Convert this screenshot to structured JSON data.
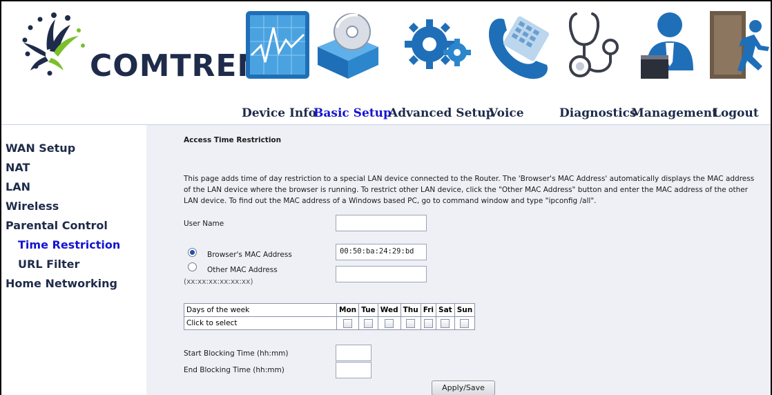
{
  "brand": {
    "name": "COMTREND",
    "accent": "#1414d2",
    "navy": "#1e2b4a"
  },
  "nav": [
    {
      "label": "Device Info",
      "icon": "monitor-chart-icon",
      "active": false
    },
    {
      "label": "Basic Setup",
      "icon": "disc-box-icon",
      "active": true
    },
    {
      "label": "Advanced Setup",
      "icon": "gears-icon",
      "active": false
    },
    {
      "label": "Voice",
      "icon": "phone-icon",
      "active": false
    },
    {
      "label": "Diagnostics",
      "icon": "stethoscope-icon",
      "active": false
    },
    {
      "label": "Management",
      "icon": "user-admin-icon",
      "active": false
    },
    {
      "label": "Logout",
      "icon": "exit-door-icon",
      "active": false
    }
  ],
  "sidebar": [
    {
      "label": "WAN Setup",
      "sub": false,
      "active": false
    },
    {
      "label": "NAT",
      "sub": false,
      "active": false
    },
    {
      "label": "LAN",
      "sub": false,
      "active": false
    },
    {
      "label": "Wireless",
      "sub": false,
      "active": false
    },
    {
      "label": "Parental Control",
      "sub": false,
      "active": false
    },
    {
      "label": "Time Restriction",
      "sub": true,
      "active": true
    },
    {
      "label": "URL Filter",
      "sub": true,
      "active": false
    },
    {
      "label": "Home Networking",
      "sub": false,
      "active": false
    }
  ],
  "page": {
    "title": "Access Time Restriction",
    "description": "This page adds time of day restriction to a special LAN device connected to the Router. The 'Browser's MAC Address' automatically displays the MAC address of the LAN device where the browser is running. To restrict other LAN device, click the \"Other MAC Address\" button and enter the MAC address of the other LAN device. To find out the MAC address of a Windows based PC, go to command window and type \"ipconfig /all\".",
    "user_name_label": "User Name",
    "user_name_value": "",
    "browser_mac_label": "Browser's MAC Address",
    "browser_mac_value": "00:50:ba:24:29:bd",
    "browser_mac_selected": true,
    "other_mac_label": "Other MAC Address",
    "other_mac_hint": "(xx:xx:xx:xx:xx:xx)",
    "other_mac_value": "",
    "days_header": "Days of the week",
    "click_to_select": "Click to select",
    "days": [
      "Mon",
      "Tue",
      "Wed",
      "Thu",
      "Fri",
      "Sat",
      "Sun"
    ],
    "start_label": "Start Blocking Time (hh:mm)",
    "start_value": "",
    "end_label": "End Blocking Time (hh:mm)",
    "end_value": "",
    "apply_label": "Apply/Save"
  }
}
